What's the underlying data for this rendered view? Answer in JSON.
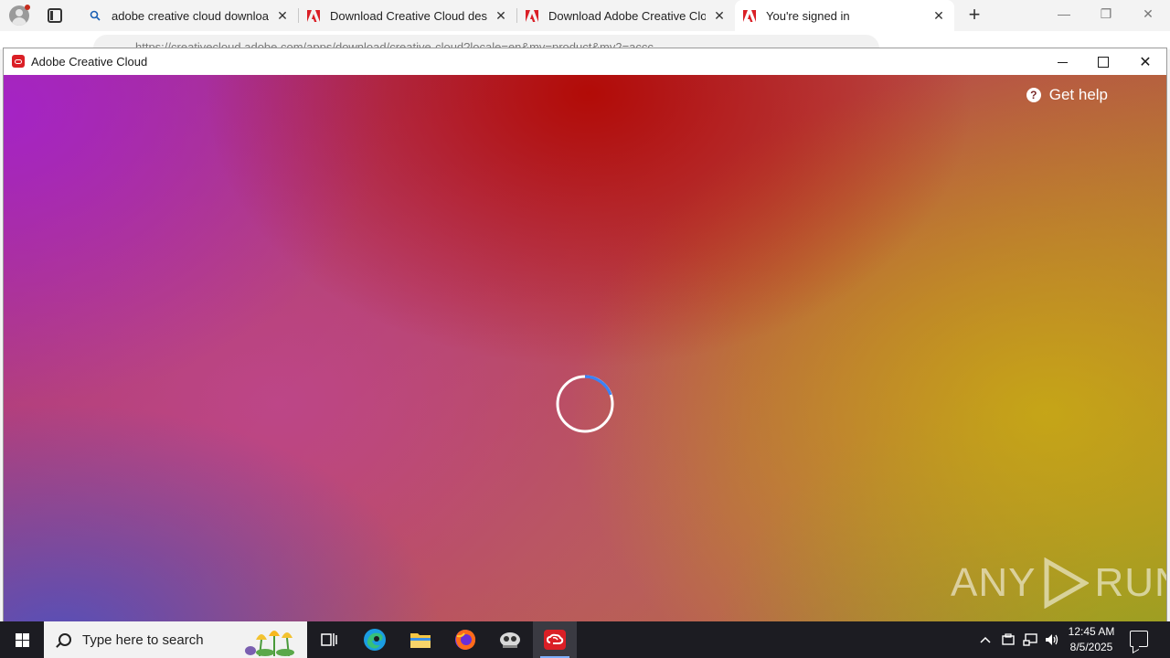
{
  "browser": {
    "tabs": [
      {
        "title": "adobe creative cloud download -",
        "favicon": "search-icon"
      },
      {
        "title": "Download Creative Cloud deskto",
        "favicon": "adobe-icon"
      },
      {
        "title": "Download Adobe Creative Cloud",
        "favicon": "adobe-icon"
      },
      {
        "title": "You're signed in",
        "favicon": "adobe-icon",
        "active": true
      }
    ],
    "close_glyph": "✕",
    "new_tab_glyph": "+",
    "address_text": "https://creativecloud.adobe.com/apps/download/creative-cloud?locale=en&mv=product&mv2=accc"
  },
  "app_window": {
    "title": "Adobe Creative Cloud",
    "close_glyph": "✕",
    "help_label": "Get help",
    "help_glyph": "?",
    "watermark": {
      "left": "ANY",
      "right": "RUN"
    }
  },
  "taskbar": {
    "search_placeholder": "Type here to search",
    "time": "12:45 AM",
    "date": "8/5/2025",
    "tray_chevron": "^"
  },
  "colors": {
    "adobe_red": "#da1f26",
    "taskbar_bg": "#1c1c22",
    "spinner_accent": "#3b82f6"
  }
}
